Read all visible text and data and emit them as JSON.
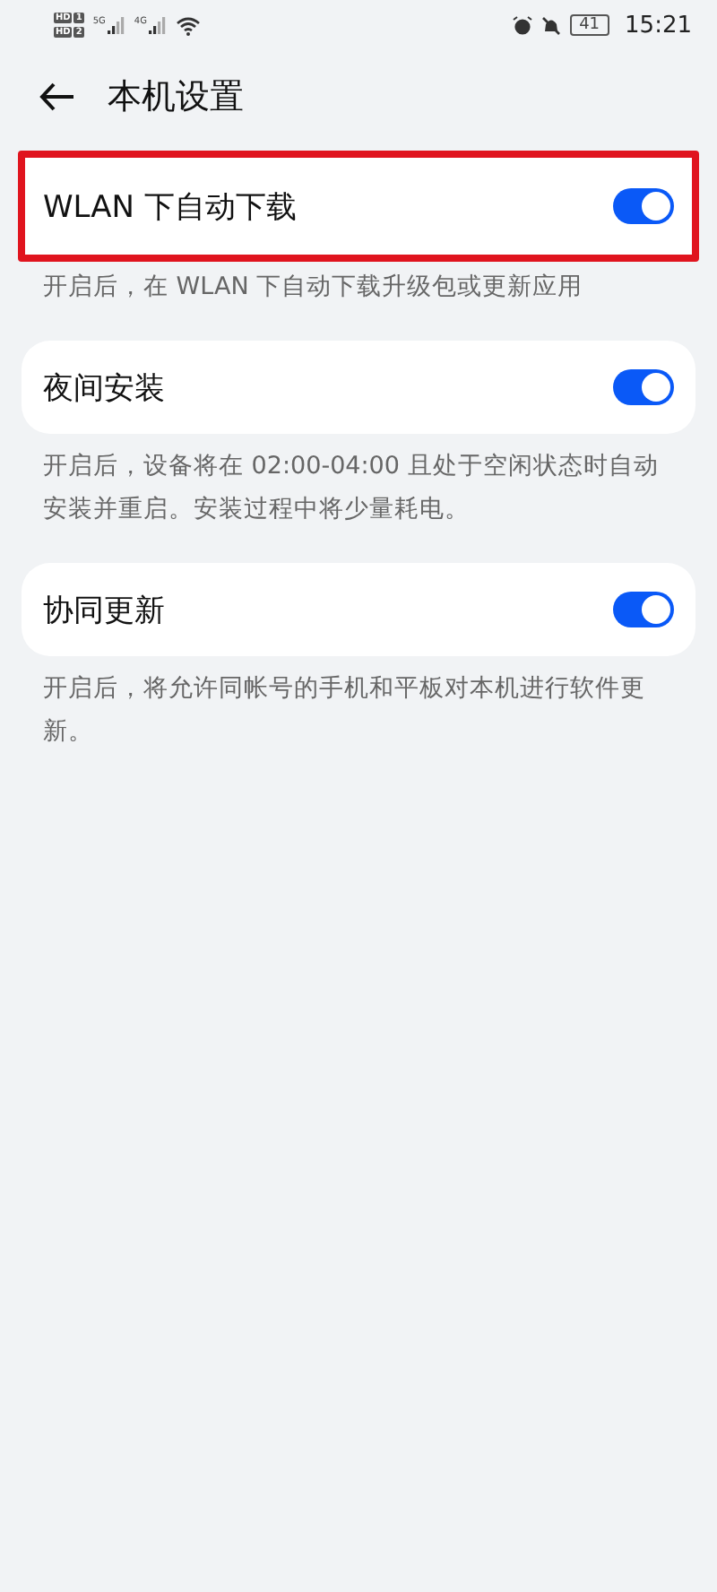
{
  "status_bar": {
    "sims": [
      {
        "label": "HD",
        "slot": "1"
      },
      {
        "label": "HD",
        "slot": "2"
      }
    ],
    "networks": [
      "5G",
      "4G"
    ],
    "battery": "41",
    "time": "15:21"
  },
  "header": {
    "title": "本机设置"
  },
  "settings": [
    {
      "label": "WLAN 下自动下载",
      "on": true,
      "highlighted": true,
      "description": "开启后，在 WLAN 下自动下载升级包或更新应用"
    },
    {
      "label": "夜间安装",
      "on": true,
      "highlighted": false,
      "description": "开启后，设备将在 02:00-04:00 且处于空闲状态时自动安装并重启。安装过程中将少量耗电。"
    },
    {
      "label": "协同更新",
      "on": true,
      "highlighted": false,
      "description": "开启后，将允许同帐号的手机和平板对本机进行软件更新。"
    }
  ]
}
